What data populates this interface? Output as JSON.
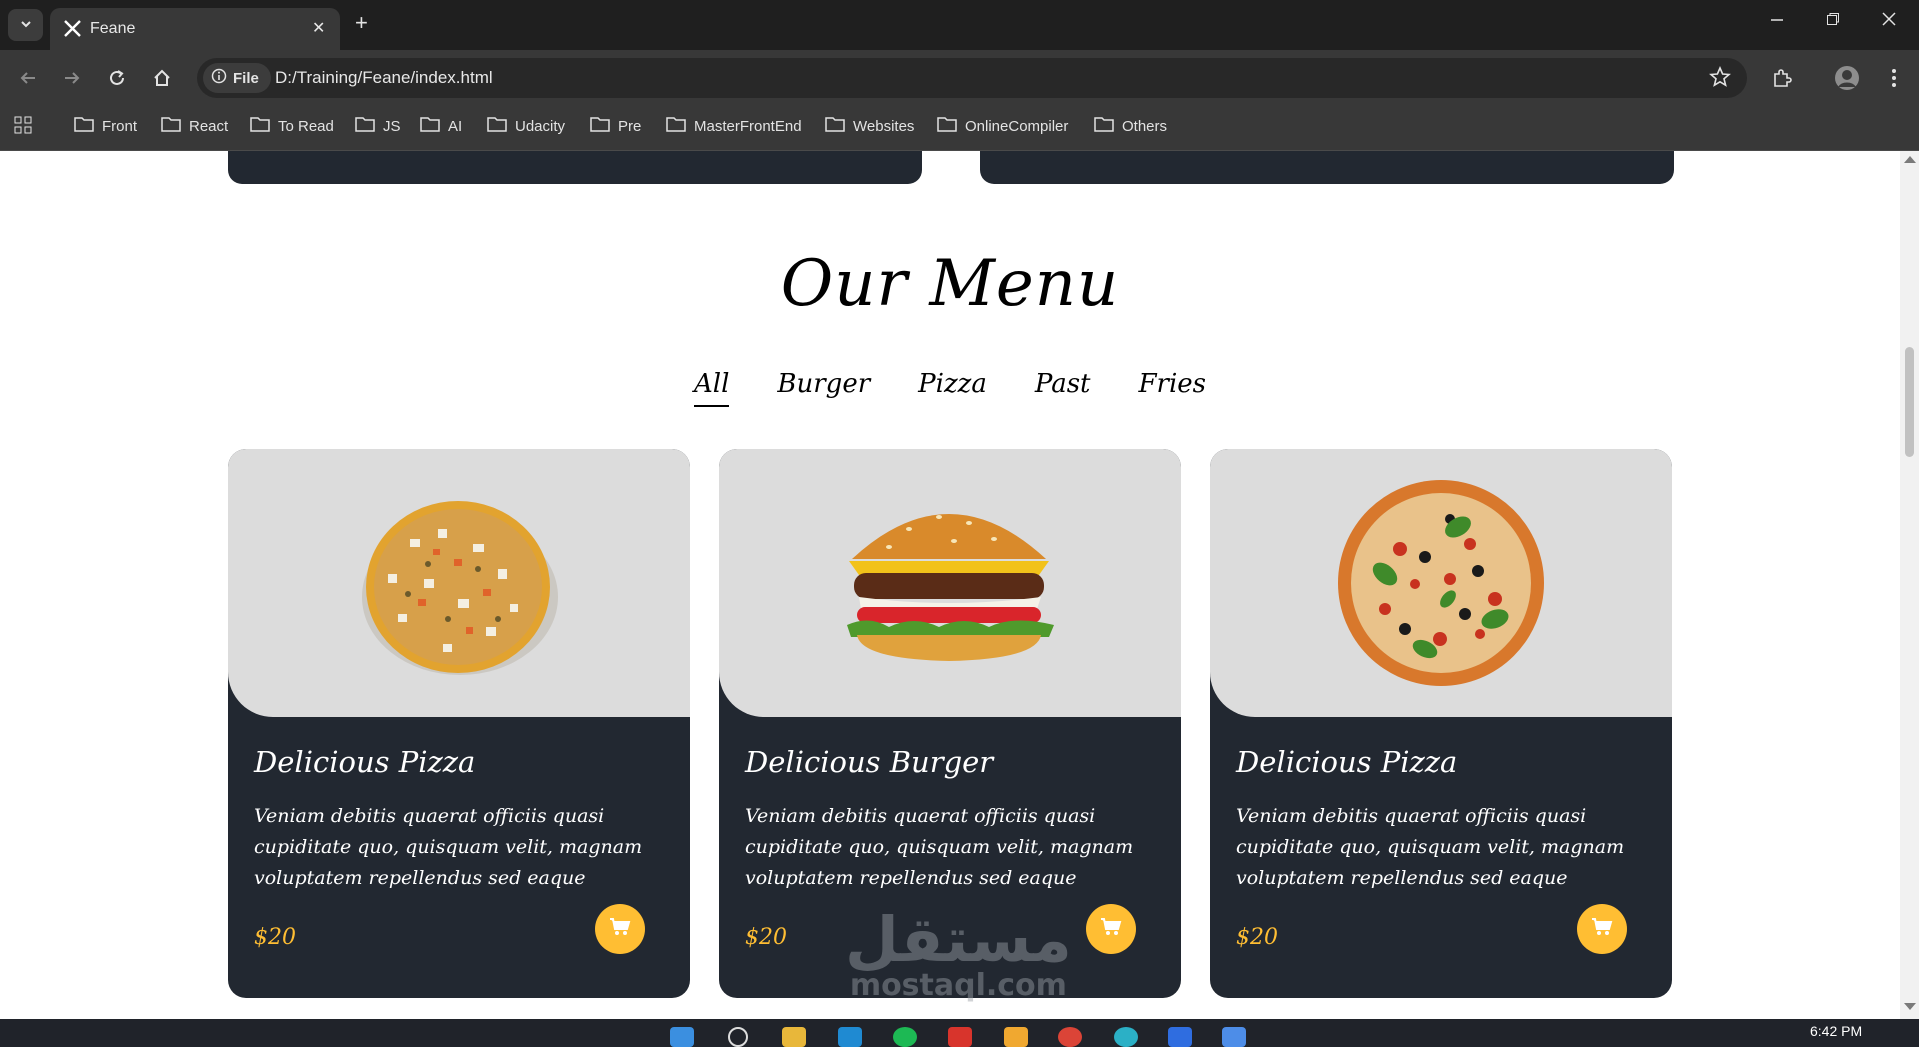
{
  "browser": {
    "tab_title": "Feane",
    "close_glyph": "✕",
    "new_tab_glyph": "+",
    "url_chip": "File",
    "url": "D:/Training/Feane/index.html",
    "bookmarks": [
      "Front",
      "React",
      "To Read",
      "JS",
      "AI",
      "Udacity",
      "Pre",
      "MasterFrontEnd",
      "Websites",
      "OnlineCompiler",
      "Others"
    ]
  },
  "page": {
    "section_title": "Our Menu",
    "filters": [
      "All",
      "Burger",
      "Pizza",
      "Past",
      "Fries"
    ],
    "active_filter": "All",
    "items": [
      {
        "name": "Delicious Pizza",
        "description": "Veniam debitis quaerat officiis quasi cupiditate quo, quisquam velit, magnam voluptatem repellendus sed eaque",
        "price": "$20",
        "image": "pizza-plain"
      },
      {
        "name": "Delicious Burger",
        "description": "Veniam debitis quaerat officiis quasi cupiditate quo, quisquam velit, magnam voluptatem repellendus sed eaque",
        "price": "$20",
        "image": "burger"
      },
      {
        "name": "Delicious Pizza",
        "description": "Veniam debitis quaerat officiis quasi cupiditate quo, quisquam velit, magnam voluptatem repellendus sed eaque",
        "price": "$20",
        "image": "pizza-basil"
      }
    ],
    "colors": {
      "card_bg": "#222831",
      "accent": "#ffbe33",
      "image_bg": "#dcdcdc"
    }
  },
  "watermark": {
    "arabic": "مستقل",
    "latin": "mostaql.com"
  },
  "taskbar": {
    "time": "6:42 PM"
  }
}
